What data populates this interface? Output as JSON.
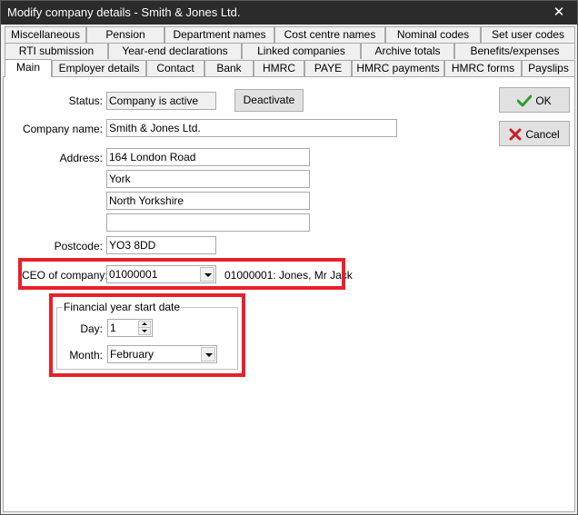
{
  "window": {
    "title": "Modify company details - Smith & Jones Ltd.",
    "close_glyph": "✕"
  },
  "tabs": {
    "row1": [
      "Miscellaneous",
      "Pension",
      "Department names",
      "Cost centre names",
      "Nominal codes",
      "Set user codes"
    ],
    "row2": [
      "RTI submission",
      "Year-end declarations",
      "Linked companies",
      "Archive totals",
      "Benefits/expenses"
    ],
    "row3": [
      "Main",
      "Employer details",
      "Contact",
      "Bank",
      "HMRC",
      "PAYE",
      "HMRC payments",
      "HMRC forms",
      "Payslips"
    ],
    "active": "Main"
  },
  "form": {
    "status_label": "Status:",
    "status_value": "Company is active",
    "deactivate_label": "Deactivate",
    "company_name_label": "Company name:",
    "company_name_value": "Smith & Jones Ltd.",
    "address_label": "Address:",
    "address_lines": [
      "164 London Road",
      "York",
      "North Yorkshire",
      ""
    ],
    "postcode_label": "Postcode:",
    "postcode_value": "YO3 8DD",
    "ceo_label": "CEO of company:",
    "ceo_value": "01000001",
    "ceo_description": "01000001: Jones, Mr Jack",
    "fy_group_label": "Financial year start date",
    "day_label": "Day:",
    "day_value": "1",
    "month_label": "Month:",
    "month_value": "February"
  },
  "buttons": {
    "ok_label": "OK",
    "cancel_label": "Cancel"
  },
  "colors": {
    "highlight": "#e8202a",
    "ok_check": "#2e9e2e",
    "cancel_x": "#c8202a"
  }
}
